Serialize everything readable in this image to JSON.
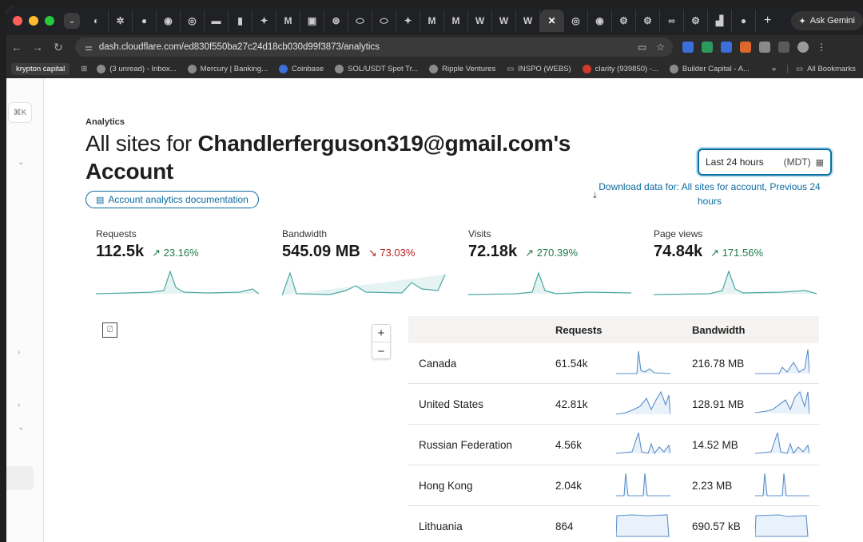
{
  "browser": {
    "url": "dash.cloudflare.com/ed830f550ba27c24d18cb030d99f3873/analytics",
    "gemini_label": "Ask Gemini",
    "bookmarks": [
      "krypton capital",
      "(3 unread) - Inbox...",
      "Mercury | Banking...",
      "Coinbase",
      "SOL/USDT Spot Tr...",
      "Ripple Ventures",
      "INSPO (WEBS)",
      "clarity (939850) -...",
      "Builder Capital - A..."
    ],
    "all_bookmarks": "All Bookmarks",
    "more_bookmarks": "»"
  },
  "sidebar": {
    "shortcut": "⌘K"
  },
  "header": {
    "breadcrumb": "Analytics",
    "title_prefix": "All sites for ",
    "title_account": "Chandlerferguson319@gmail.com's",
    "title_suffix": "Account",
    "doc_link": "Account analytics documentation"
  },
  "range": {
    "label": "Last 24 hours",
    "timezone": "(MDT)",
    "download": "Download data for: All sites for account, Previous 24 hours"
  },
  "metrics": [
    {
      "label": "Requests",
      "value": "112.5k",
      "delta": "23.16%",
      "trend": "up"
    },
    {
      "label": "Bandwidth",
      "value": "545.09 MB",
      "delta": "73.03%",
      "trend": "down"
    },
    {
      "label": "Visits",
      "value": "72.18k",
      "delta": "270.39%",
      "trend": "up"
    },
    {
      "label": "Page views",
      "value": "74.84k",
      "delta": "171.56%",
      "trend": "up"
    }
  ],
  "table": {
    "headers": {
      "requests": "Requests",
      "bandwidth": "Bandwidth"
    },
    "rows": [
      {
        "country": "Canada",
        "requests": "61.54k",
        "bandwidth": "216.78 MB"
      },
      {
        "country": "United States",
        "requests": "42.81k",
        "bandwidth": "128.91 MB"
      },
      {
        "country": "Russian Federation",
        "requests": "4.56k",
        "bandwidth": "14.52 MB"
      },
      {
        "country": "Hong Kong",
        "requests": "2.04k",
        "bandwidth": "2.23 MB"
      },
      {
        "country": "Lithuania",
        "requests": "864",
        "bandwidth": "690.57 kB"
      }
    ]
  },
  "colors": {
    "accent": "#0b6aa0",
    "up": "#1f7a4a",
    "down": "#b32020",
    "spark": "#4aa7a0",
    "table_spark": "#5b8fc9"
  }
}
